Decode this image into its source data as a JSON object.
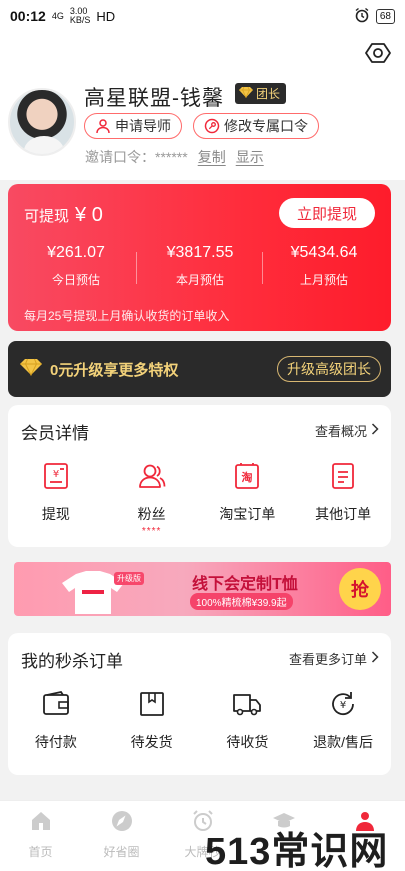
{
  "status": {
    "time": "00:12",
    "network": "4G",
    "speed_value": "3.00",
    "speed_unit": "KB/S",
    "hd": "HD",
    "battery": "68"
  },
  "profile": {
    "name": "高星联盟-钱馨",
    "role_badge": "团长",
    "apply_mentor": "申请导师",
    "edit_code": "修改专属口令",
    "invite_label": "邀请口令：******",
    "copy": "复制",
    "show": "显示"
  },
  "earnings": {
    "withdrawable_label": "可提现",
    "withdrawable_amount": "¥ 0",
    "withdraw_button": "立即提现",
    "stats": [
      {
        "value": "¥261.07",
        "label": "今日预估"
      },
      {
        "value": "¥3817.55",
        "label": "本月预估"
      },
      {
        "value": "¥5434.64",
        "label": "上月预估"
      }
    ],
    "note": "每月25号提现上月确认收货的订单收入"
  },
  "vip": {
    "text": "0元升级享更多特权",
    "button": "升级高级团长"
  },
  "member": {
    "title": "会员详情",
    "more": "查看概况",
    "items": [
      {
        "label": "提现",
        "icon": "withdraw-icon",
        "sub": ""
      },
      {
        "label": "粉丝",
        "icon": "fans-icon",
        "sub": "****"
      },
      {
        "label": "淘宝订单",
        "icon": "taobao-order-icon",
        "sub": ""
      },
      {
        "label": "其他订单",
        "icon": "other-order-icon",
        "sub": ""
      }
    ]
  },
  "banner": {
    "tag": "升级版",
    "title": "线下会定制T恤",
    "sub": "100%精梳棉¥39.9起",
    "button": "抢"
  },
  "flash_orders": {
    "title": "我的秒杀订单",
    "more": "查看更多订单",
    "items": [
      {
        "label": "待付款",
        "icon": "wallet-icon"
      },
      {
        "label": "待发货",
        "icon": "package-icon"
      },
      {
        "label": "待收货",
        "icon": "truck-icon"
      },
      {
        "label": "退款/售后",
        "icon": "refund-icon"
      }
    ]
  },
  "tabs": [
    {
      "label": "首页",
      "icon": "home-icon"
    },
    {
      "label": "好省圈",
      "icon": "compass-icon"
    },
    {
      "label": "大牌秒",
      "icon": "alarm-icon"
    },
    {
      "label": "",
      "icon": "graduation-icon"
    },
    {
      "label": "",
      "icon": "person-icon"
    }
  ],
  "watermark": "513常识网",
  "colors": {
    "accent": "#f0283a",
    "gold": "#f3d27a",
    "dark": "#2a2a2a"
  }
}
